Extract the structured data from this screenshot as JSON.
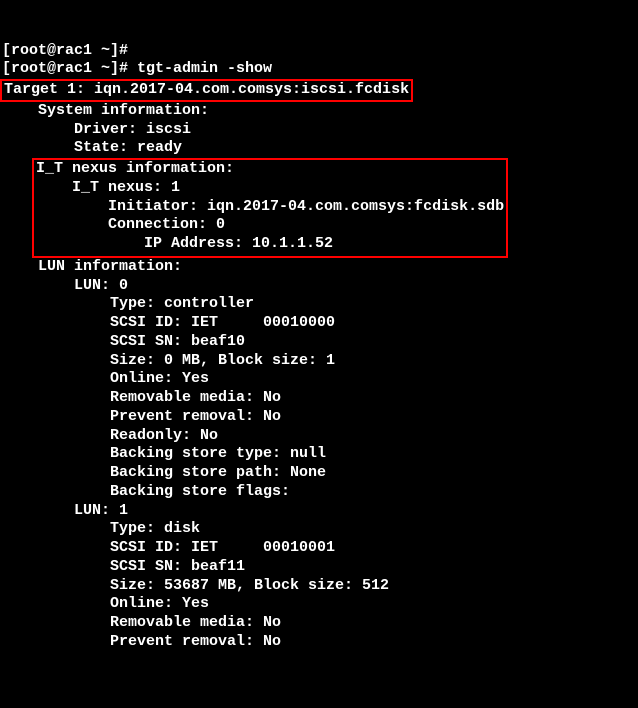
{
  "prompts": [
    "[root@rac1 ~]#",
    "[root@rac1 ~]# tgt-admin -show"
  ],
  "target_line": "Target 1: iqn.2017-04.com.comsys:iscsi.fcdisk",
  "system_info": {
    "header": "    System information:",
    "driver": "        Driver: iscsi",
    "state": "        State: ready"
  },
  "nexus": {
    "header": "I_T nexus information:",
    "nexus_num": "    I_T nexus: 1",
    "initiator": "        Initiator: iqn.2017-04.com.comsys:fcdisk.sdb",
    "connection": "        Connection: 0",
    "ip": "            IP Address: 10.1.1.52"
  },
  "lun_info_header": "    LUN information:",
  "lun0": {
    "header": "        LUN: 0",
    "type": "            Type: controller",
    "scsi_id": "            SCSI ID: IET     00010000",
    "scsi_sn": "            SCSI SN: beaf10",
    "size": "            Size: 0 MB, Block size: 1",
    "online": "            Online: Yes",
    "removable": "            Removable media: No",
    "prevent": "            Prevent removal: No",
    "readonly": "            Readonly: No",
    "bstype": "            Backing store type: null",
    "bspath": "            Backing store path: None",
    "bsflags": "            Backing store flags:"
  },
  "lun1": {
    "header": "        LUN: 1",
    "type": "            Type: disk",
    "scsi_id": "            SCSI ID: IET     00010001",
    "scsi_sn": "            SCSI SN: beaf11",
    "size": "            Size: 53687 MB, Block size: 512",
    "online": "            Online: Yes",
    "removable": "            Removable media: No",
    "prevent": "            Prevent removal: No"
  }
}
